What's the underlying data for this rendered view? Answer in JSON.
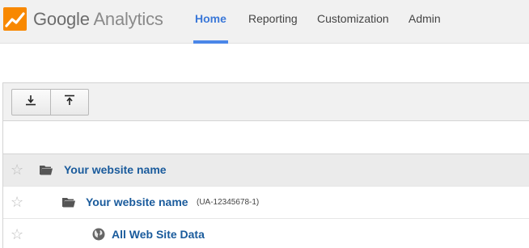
{
  "header": {
    "brand_google": "Google",
    "brand_analytics": "Analytics",
    "nav": [
      {
        "label": "Home",
        "active": true
      },
      {
        "label": "Reporting",
        "active": false
      },
      {
        "label": "Customization",
        "active": false
      },
      {
        "label": "Admin",
        "active": false
      }
    ]
  },
  "toolbar": {
    "buttons": [
      {
        "icon": "arrow-down-to-line-icon"
      },
      {
        "icon": "arrow-up-to-line-icon"
      }
    ]
  },
  "tree": {
    "account": {
      "name": "Your website name",
      "starred": false
    },
    "property": {
      "name": "Your website name",
      "tracking_id": "(UA-12345678-1)",
      "starred": false
    },
    "view": {
      "name": "All Web Site Data",
      "starred": false
    }
  },
  "colors": {
    "accent": "#4a86e8",
    "link": "#1a5b9c",
    "logo_orange": "#f57c00"
  }
}
